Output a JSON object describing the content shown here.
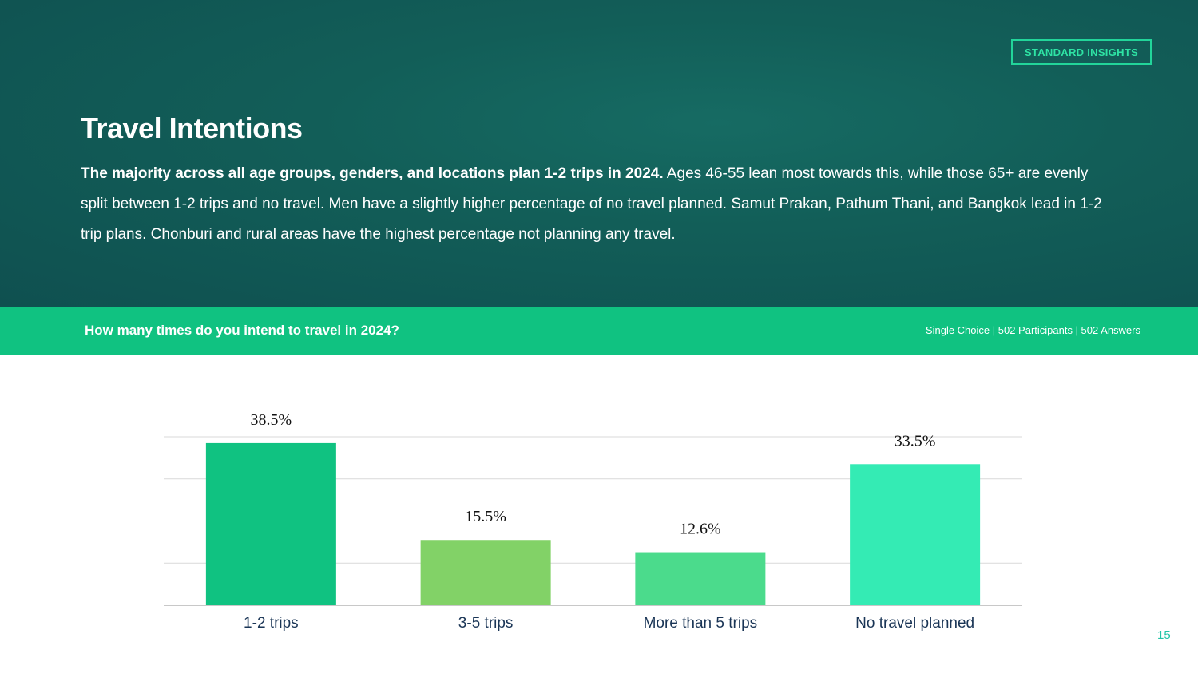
{
  "badge": "STANDARD INSIGHTS",
  "title": "Travel Intentions",
  "summary": {
    "lead": "The majority across all age groups, genders, and locations plan 1-2 trips in 2024.",
    "body": " Ages 46-55 lean most towards this, while those 65+ are evenly split between 1-2 trips and no travel. Men have a slightly higher percentage of no travel planned. Samut Prakan, Pathum Thani, and Bangkok lead in 1-2 trip plans. Chonburi and rural areas have the highest percentage not planning any travel."
  },
  "question": {
    "text": "How many times do you intend to travel in 2024?",
    "meta": "Single Choice | 502 Participants | 502 Answers"
  },
  "colors": {
    "hero_bg": "#125e58",
    "accent": "#10c281",
    "badge": "#22d59a"
  },
  "chart_data": {
    "type": "bar",
    "categories": [
      "1-2 trips",
      "3-5 trips",
      "More than 5 trips",
      "No travel planned"
    ],
    "values": [
      38.5,
      15.5,
      12.6,
      33.5
    ],
    "data_labels": [
      "38.5%",
      "15.5%",
      "12.6%",
      "33.5%"
    ],
    "colors": [
      "#10c281",
      "#82d267",
      "#4bdb8c",
      "#34ebb4"
    ],
    "ylim": [
      0,
      40
    ],
    "grid": true,
    "title": "",
    "xlabel": "",
    "ylabel": ""
  },
  "page_number": "15"
}
